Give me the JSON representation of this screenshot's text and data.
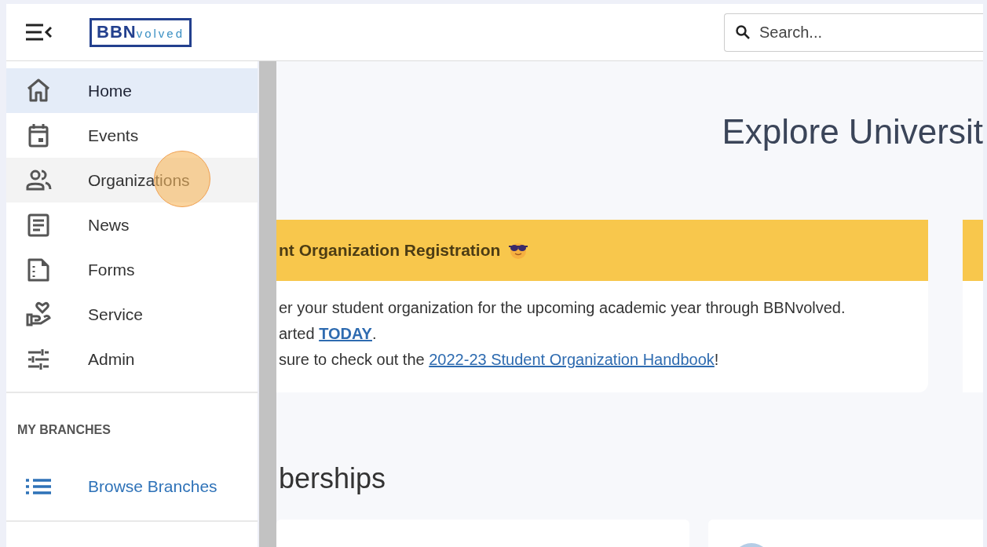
{
  "header": {
    "logo": "**BBN**volved",
    "search": {
      "placeholder": "Search..."
    }
  },
  "sidebar": {
    "items": [
      {
        "label": "Home",
        "selected": true,
        "hovered": false
      },
      {
        "label": "Events",
        "selected": false,
        "hovered": false
      },
      {
        "label": "Organizations",
        "selected": false,
        "hovered": true
      },
      {
        "label": "News",
        "selected": false,
        "hovered": false
      },
      {
        "label": "Forms",
        "selected": false,
        "hovered": false
      },
      {
        "label": "Service",
        "selected": false,
        "hovered": false
      },
      {
        "label": "Admin",
        "selected": false,
        "hovered": false
      }
    ],
    "branches_heading": "MY BRANCHES",
    "branches_link": "Browse Branches"
  },
  "main": {
    "title": "Explore Universit",
    "announcement": {
      "title": "nt Organization Registration",
      "lines": [
        {
          "text": "er your student organization for the upcoming academic year through BBNvolved."
        },
        {
          "text": "arted ",
          "link": "TODAY",
          "after": ".",
          "bold_link": true
        },
        {
          "text": "sure to check out the ",
          "link": "2022-23 Student Organization Handbook",
          "after": "!",
          "bold_link": false
        }
      ]
    },
    "memberships_heading": "berships"
  }
}
